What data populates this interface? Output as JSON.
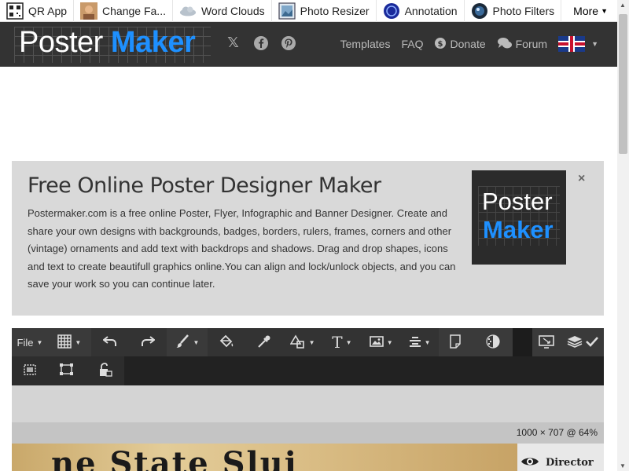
{
  "appbar": {
    "apps": [
      {
        "label": "QR App",
        "icon": "qr-code-icon"
      },
      {
        "label": "Change Fa...",
        "icon": "face-avatar-icon"
      },
      {
        "label": "Word Clouds",
        "icon": "cloud-icon"
      },
      {
        "label": "Photo Resizer",
        "icon": "photo-icon"
      },
      {
        "label": "Annotation",
        "icon": "annotation-icon"
      },
      {
        "label": "Photo Filters",
        "icon": "camera-lens-icon"
      }
    ],
    "more_label": "More"
  },
  "header": {
    "logo_word1": "Poster",
    "logo_word2": "Maker",
    "nav": {
      "templates": "Templates",
      "faq": "FAQ",
      "donate": "Donate",
      "forum": "Forum"
    }
  },
  "info": {
    "title": "Free Online Poster Designer Maker",
    "body": "Postermaker.com is a free online Poster, Flyer, Infographic and Banner Designer. Create and share your own designs with backgrounds, badges, borders, rulers, frames, corners and other (vintage) ornaments and add text with backdrops and shadows. Drag and drop shapes, icons and text to create beautifull graphics online.You can align and lock/unlock objects, and you can save your work so you can continue later.",
    "logo_word1": "Poster",
    "logo_word2": "Maker",
    "close": "×"
  },
  "toolbar": {
    "file_label": "File"
  },
  "canvas": {
    "status": "1000 × 707 @ 64%",
    "poster_text": "ne State Slui",
    "layer_label": "Director"
  },
  "colors": {
    "accent": "#1e90ff",
    "header_bg": "#333333",
    "info_bg": "#d9d9d9",
    "toolbar_bg": "#2d2d2d"
  }
}
